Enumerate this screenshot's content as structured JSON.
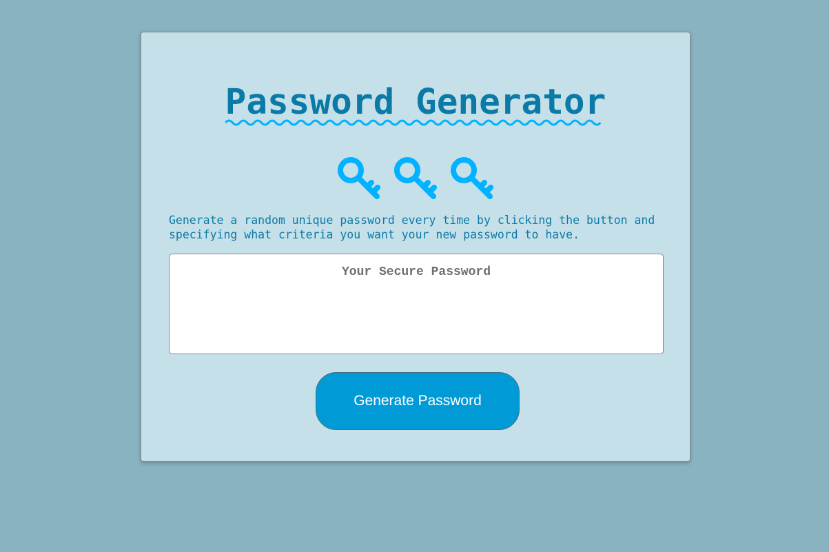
{
  "header": {
    "title": "Password Generator"
  },
  "icons": [
    "key-icon",
    "key-icon",
    "key-icon"
  ],
  "description": "Generate a random unique password every time by clicking the button and specifying what criteria you want your new password to have.",
  "password_field": {
    "placeholder": "Your Secure Password",
    "value": ""
  },
  "generate_button": {
    "label": "Generate Password"
  },
  "colors": {
    "page_background": "#8ab3c1",
    "card_background": "#c5e0e9",
    "title_text": "#0b7aa7",
    "accent": "#00b2ff",
    "button": "#009bd7"
  }
}
